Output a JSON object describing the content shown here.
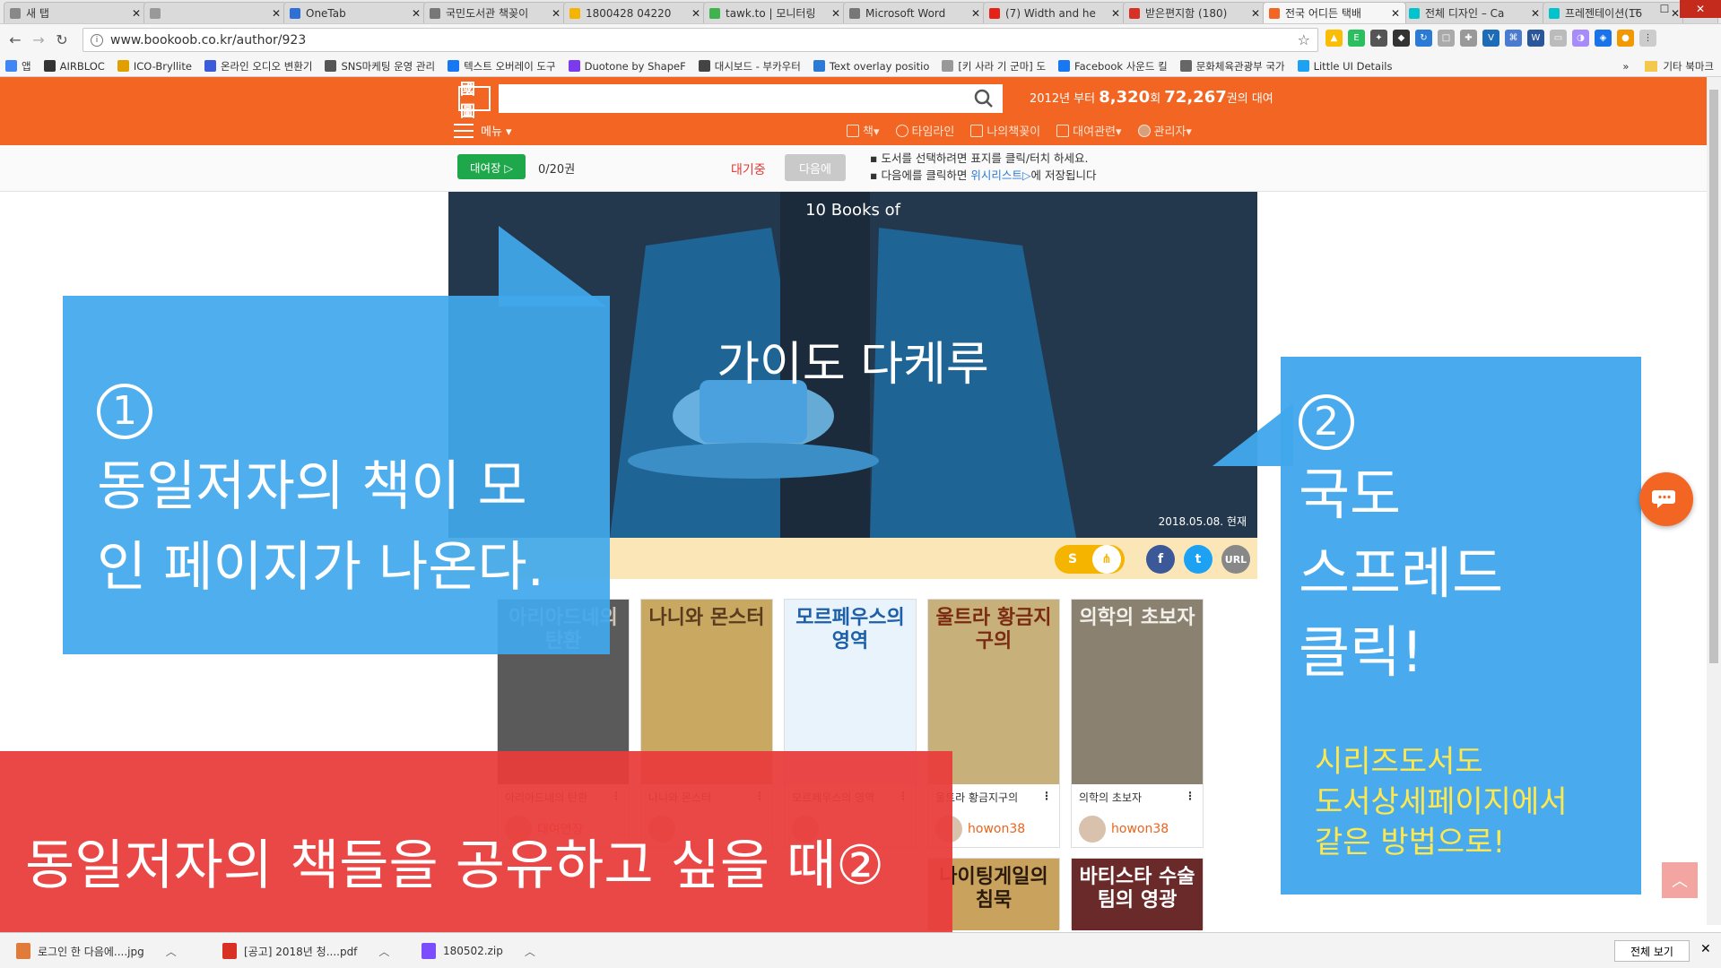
{
  "browser": {
    "tabs": [
      {
        "title": "새 탭",
        "color": "#888888"
      },
      {
        "title": "",
        "color": "#999999"
      },
      {
        "title": "OneTab",
        "color": "#2f6fd6"
      },
      {
        "title": "국민도서관 책꽂이",
        "color": "#777777"
      },
      {
        "title": "1800428 04220",
        "color": "#f4b400"
      },
      {
        "title": "tawk.to | 모니터링",
        "color": "#3fb34f"
      },
      {
        "title": "Microsoft Word",
        "color": "#777777"
      },
      {
        "title": "(7) Width and he",
        "color": "#e62117"
      },
      {
        "title": "받은편지함 (180)",
        "color": "#d93025"
      },
      {
        "title": "전국 어디든 택배",
        "color": "#f26522"
      },
      {
        "title": "전체 디자인 – Ca",
        "color": "#00c4cc"
      },
      {
        "title": "프레젠테이션(16",
        "color": "#00c4cc"
      }
    ],
    "url": "www.bookoob.co.kr/author/923",
    "bookmarks": [
      {
        "label": "앱",
        "color": "#4285f4"
      },
      {
        "label": "AIRBLOC",
        "color": "#333333"
      },
      {
        "label": "ICO-Bryllite",
        "color": "#e0a100"
      },
      {
        "label": "온라인 오디오 변환기",
        "color": "#3b5bdb"
      },
      {
        "label": "SNS마케팅 운영 관리",
        "color": "#555555"
      },
      {
        "label": "텍스트 오버레이 도구",
        "color": "#1877f2"
      },
      {
        "label": "Duotone by ShapeF",
        "color": "#7c3aed"
      },
      {
        "label": "대시보드 - 부카우터",
        "color": "#444444"
      },
      {
        "label": "Text overlay positio",
        "color": "#2b7bd6"
      },
      {
        "label": "[키 사라 기 군마] 도",
        "color": "#999999"
      },
      {
        "label": "Facebook 사운드 킬",
        "color": "#1877f2"
      },
      {
        "label": "문화체육관광부 국가",
        "color": "#666666"
      },
      {
        "label": "Little UI Details",
        "color": "#1da1f2"
      }
    ],
    "bookmarks_more": "»",
    "other_bookmarks": "기타 북마크"
  },
  "site": {
    "logo": "國圖",
    "stats_prefix": "2012년 부터",
    "stats_count1": "8,320",
    "stats_unit1": "회",
    "stats_count2": "72,267",
    "stats_suffix": "권의 대여",
    "menu_label": "메뉴 ▾",
    "nav": [
      "책▾",
      "타임라인",
      "나의책꽂이",
      "대여관련▾",
      "관리자▾"
    ],
    "rent_button": "대여장 ▷",
    "rent_count": "0/20권",
    "waiting_label": "대기중",
    "next_button": "다음에",
    "note_line1": "도서를 선택하려면 표지를 클릭/터치 하세요.",
    "note_line2_prefix": "다음에를 클릭하면",
    "note_line2_link": "위시리스트▷",
    "note_line2_suffix": "에 저장됩니다"
  },
  "banner": {
    "top_text": "10 Books of",
    "title": "가이도 다케루",
    "date": "2018.05.08. 현재"
  },
  "share": {
    "s_label": "S",
    "url_label": "URL",
    "colors": {
      "facebook": "#3b5998",
      "twitter": "#1da1f2",
      "url": "#888888",
      "kakaostory": "#f4b400"
    }
  },
  "books": [
    {
      "cover_title": "아리아드네의 탄환",
      "title": "아리아드네의 탄환",
      "user": "대여연장",
      "cover_color": "#5a5a5a",
      "text_color": "#d0c7b8"
    },
    {
      "cover_title": "나니와 몬스터",
      "title": "나니와 몬스터",
      "user": "",
      "cover_color": "#c9a962",
      "text_color": "#5a3b1e"
    },
    {
      "cover_title": "모르페우스의 영역",
      "title": "모르페우스의 영역",
      "user": "",
      "cover_color": "#e9f3fb",
      "text_color": "#1d5fa8"
    },
    {
      "cover_title": "울트라 황금지구의",
      "title": "울트라 황금지구의",
      "user": "howon38",
      "cover_color": "#c7b07a",
      "text_color": "#7a2b12"
    },
    {
      "cover_title": "의학의 초보자",
      "title": "의학의 초보자",
      "user": "howon38",
      "cover_color": "#8a8170",
      "text_color": "#f2f0ea"
    }
  ],
  "books_row2": [
    "나이팅게일의 침묵",
    "바티스타 수술팀의 영광"
  ],
  "overlay": {
    "left_num": "①",
    "left_line1": "동일저자의 책이 모",
    "left_line2": "인 페이지가 나온다.",
    "right_num": "②",
    "right_line1": "국도",
    "right_line2": "스프레드",
    "right_line3": "클릭!",
    "yellow_line1": "시리즈도서도",
    "yellow_line2": "도서상세페이지에서",
    "yellow_line3": "같은 방법으로!",
    "red_text": "동일저자의 책들을 공유하고 싶을 때②"
  },
  "downloads": [
    {
      "name": "로그인 한 다음에....jpg",
      "color": "#e07b39"
    },
    {
      "name": "[공고] 2018년 청....pdf",
      "color": "#d93025"
    },
    {
      "name": "180502.zip",
      "color": "#7c4dff"
    }
  ],
  "show_all": "전체 보기"
}
